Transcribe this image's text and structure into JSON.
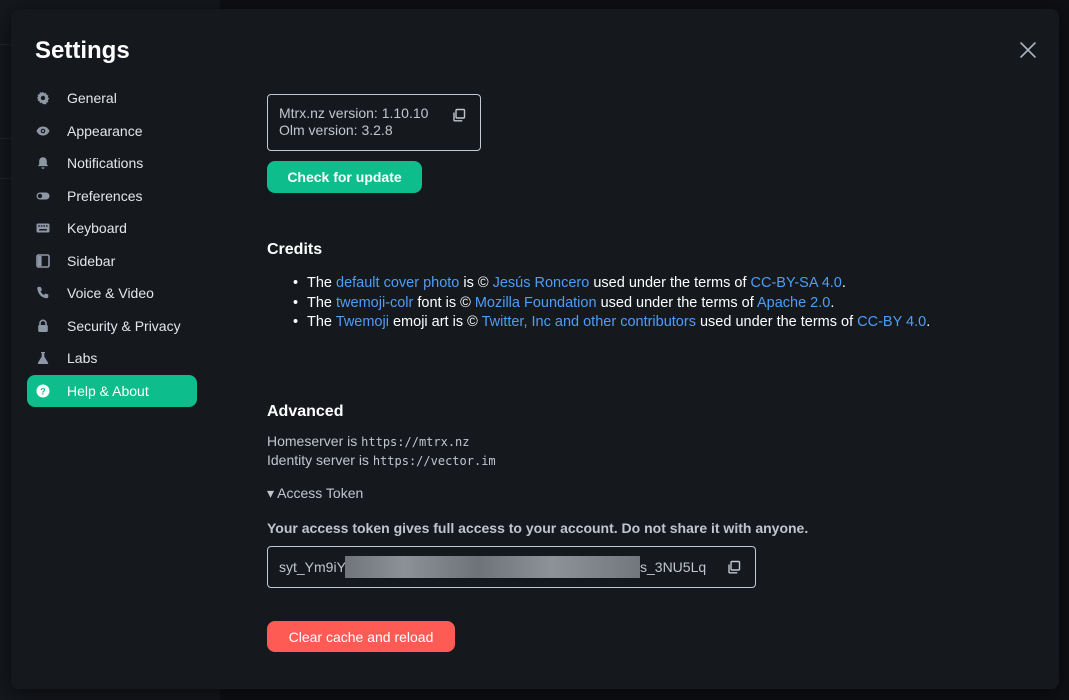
{
  "dialog": {
    "title": "Settings"
  },
  "sidebar": {
    "items": [
      {
        "label": "General",
        "icon": "gear-icon"
      },
      {
        "label": "Appearance",
        "icon": "eye-icon"
      },
      {
        "label": "Notifications",
        "icon": "bell-icon"
      },
      {
        "label": "Preferences",
        "icon": "toggle-icon"
      },
      {
        "label": "Keyboard",
        "icon": "keyboard-icon"
      },
      {
        "label": "Sidebar",
        "icon": "sidebar-icon"
      },
      {
        "label": "Voice & Video",
        "icon": "phone-icon"
      },
      {
        "label": "Security & Privacy",
        "icon": "lock-icon"
      },
      {
        "label": "Labs",
        "icon": "flask-icon"
      },
      {
        "label": "Help & About",
        "icon": "help-icon",
        "active": true
      }
    ]
  },
  "version": {
    "app_line": "Mtrx.nz version: 1.10.10",
    "olm_line": "Olm version: 3.2.8"
  },
  "buttons": {
    "check_update": "Check for update",
    "clear_cache": "Clear cache and reload"
  },
  "credits": {
    "heading": "Credits",
    "items": [
      {
        "t1": "The ",
        "link1": "default cover photo",
        "t2": " is © ",
        "link2": "Jesús Roncero",
        "t3": " used under the terms of ",
        "link3": "CC-BY-SA 4.0",
        "t4": "."
      },
      {
        "t1": "The ",
        "link1": "twemoji-colr",
        "t2": " font is © ",
        "link2": "Mozilla Foundation",
        "t3": " used under the terms of ",
        "link3": "Apache 2.0",
        "t4": "."
      },
      {
        "t1": "The ",
        "link1": "Twemoji",
        "t2": " emoji art is © ",
        "link2": "Twitter, Inc and other contributors",
        "t3": " used under the terms of ",
        "link3": "CC-BY 4.0",
        "t4": "."
      }
    ]
  },
  "advanced": {
    "heading": "Advanced",
    "homeserver_label": "Homeserver is ",
    "homeserver_url": "https://mtrx.nz",
    "identity_label": "Identity server is ",
    "identity_url": "https://vector.im",
    "token_toggle": "▾ Access Token",
    "token_warning": "Your access token gives full access to your account. Do not share it with anyone.",
    "token_prefix": "syt_Ym9iY",
    "token_suffix": "s_3NU5Lq"
  },
  "colors": {
    "accent": "#0dbd8b",
    "link": "#4d9ef7",
    "danger": "#ff5b55",
    "dialog_bg": "#15191e"
  }
}
